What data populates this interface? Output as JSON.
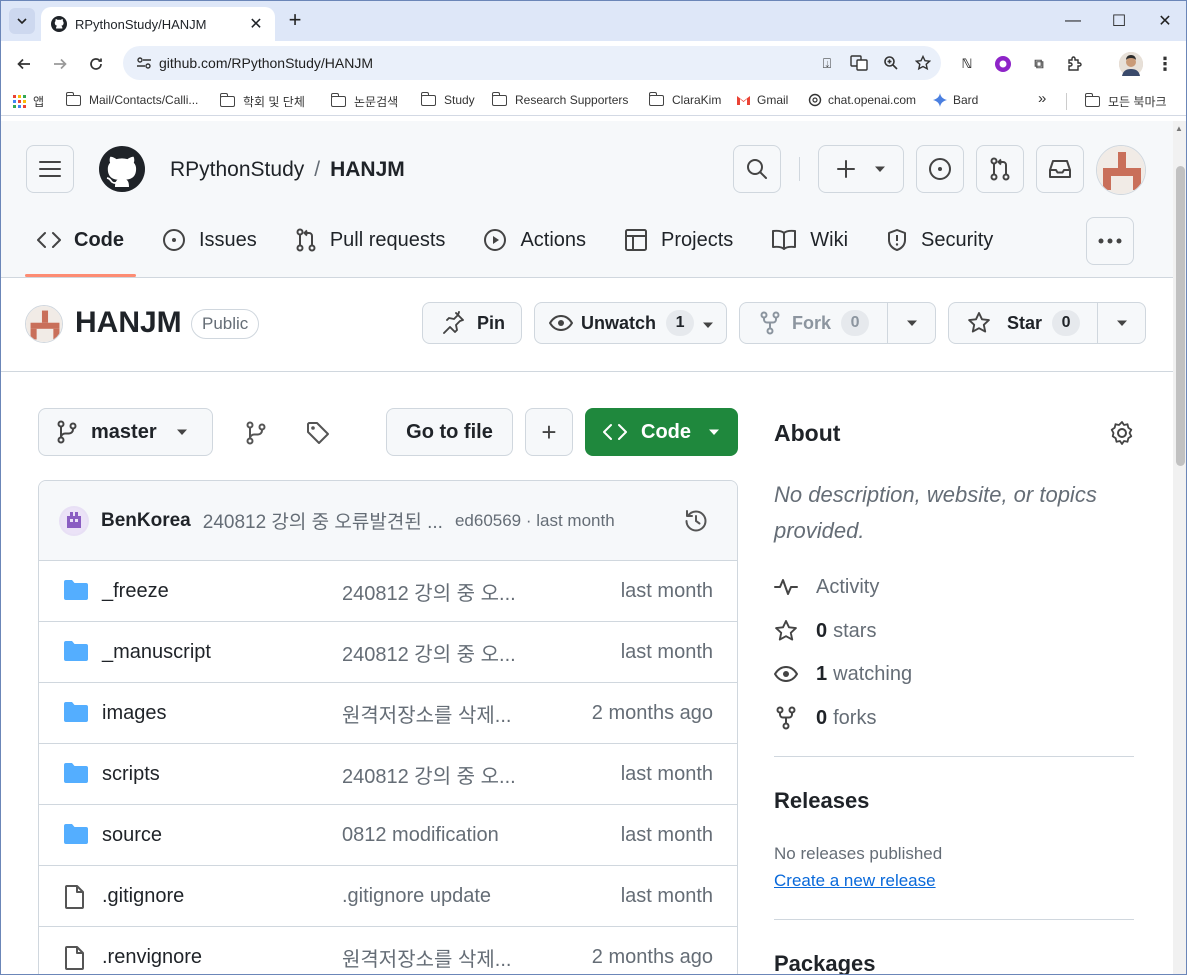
{
  "browser": {
    "tab_title": "RPythonStudy/HANJM",
    "url": "github.com/RPythonStudy/HANJM",
    "bookmarks": [
      {
        "label": "앱",
        "icon": "apps-grid-icon"
      },
      {
        "label": "Mail/Contacts/Calli...",
        "icon": "folder-icon"
      },
      {
        "label": "학회 및 단체",
        "icon": "folder-icon"
      },
      {
        "label": "논문검색",
        "icon": "folder-icon"
      },
      {
        "label": "Study",
        "icon": "folder-icon"
      },
      {
        "label": "Research Supporters",
        "icon": "folder-icon"
      },
      {
        "label": "ClaraKim",
        "icon": "folder-icon"
      },
      {
        "label": "Gmail",
        "icon": "gmail-icon"
      },
      {
        "label": "chat.openai.com",
        "icon": "openai-icon"
      },
      {
        "label": "Bard",
        "icon": "bard-sparkle-icon"
      }
    ],
    "bookmarks_overflow": "»",
    "all_bookmarks": "모든 북마크"
  },
  "header": {
    "owner": "RPythonStudy",
    "separator": "/",
    "repo": "HANJM"
  },
  "repo_nav": [
    {
      "label": "Code",
      "icon": "code-icon",
      "active": true
    },
    {
      "label": "Issues",
      "icon": "issue-opened-icon",
      "active": false
    },
    {
      "label": "Pull requests",
      "icon": "git-pull-request-icon",
      "active": false
    },
    {
      "label": "Actions",
      "icon": "play-icon",
      "active": false
    },
    {
      "label": "Projects",
      "icon": "table-icon",
      "active": false
    },
    {
      "label": "Wiki",
      "icon": "book-icon",
      "active": false
    },
    {
      "label": "Security",
      "icon": "shield-icon",
      "active": false
    }
  ],
  "repo_title": {
    "name": "HANJM",
    "visibility": "Public",
    "pin_label": "Pin",
    "unwatch_label": "Unwatch",
    "watch_count": "1",
    "fork_label": "Fork",
    "fork_count": "0",
    "star_label": "Star",
    "star_count": "0"
  },
  "code_toolbar": {
    "branch": "master",
    "go_to_file": "Go to file",
    "add": "+",
    "code": "Code"
  },
  "latest_commit": {
    "author": "BenKorea",
    "message": "240812 강의 중 오류발견된 ...",
    "meta": "ed60569 · last month"
  },
  "files": [
    {
      "type": "folder",
      "name": "_freeze",
      "message": "240812 강의 중 오...",
      "date": "last month"
    },
    {
      "type": "folder",
      "name": "_manuscript",
      "message": "240812 강의 중 오...",
      "date": "last month"
    },
    {
      "type": "folder",
      "name": "images",
      "message": "원격저장소를 삭제...",
      "date": "2 months ago"
    },
    {
      "type": "folder",
      "name": "scripts",
      "message": "240812 강의 중 오...",
      "date": "last month"
    },
    {
      "type": "folder",
      "name": "source",
      "message": "0812 modification",
      "date": "last month"
    },
    {
      "type": "file",
      "name": ".gitignore",
      "message": ".gitignore update",
      "date": "last month"
    },
    {
      "type": "file",
      "name": ".renvignore",
      "message": "원격저장소를 삭제...",
      "date": "2 months ago"
    }
  ],
  "about": {
    "heading": "About",
    "description": "No description, website, or topics provided.",
    "activity": "Activity",
    "stars_count": "0",
    "stars_label": "stars",
    "watching_count": "1",
    "watching_label": "watching",
    "forks_count": "0",
    "forks_label": "forks"
  },
  "releases": {
    "heading": "Releases",
    "none": "No releases published",
    "create": "Create a new release"
  },
  "packages": {
    "heading": "Packages"
  },
  "colors": {
    "accent_green": "#1f883d",
    "link_blue": "#0969da",
    "active_tab_underline": "#fd8c73"
  }
}
